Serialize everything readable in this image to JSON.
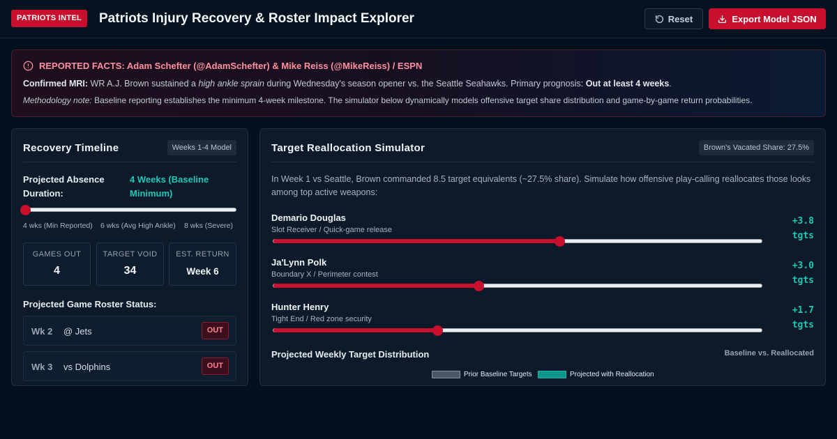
{
  "header": {
    "badge": "PATRIOTS INTEL",
    "title": "Patriots Injury Recovery & Roster Impact Explorer",
    "reset_label": "Reset",
    "export_label": "Export Model JSON"
  },
  "alert": {
    "title": "REPORTED FACTS: Adam Schefter (@AdamSchefter) & Mike Reiss (@MikeReiss) / ESPN",
    "mri_label": "Confirmed MRI:",
    "mri_text_1": "WR A.J. Brown sustained a",
    "mri_emphasis": "high ankle sprain",
    "mri_text_2": "during Wednesday's season opener vs. the Seattle Seahawks. Primary prognosis:",
    "mri_prognosis": "Out at least 4 weeks",
    "mri_end": ".",
    "method_label": "Methodology note:",
    "method_text": "Baseline reporting establishes the minimum 4-week milestone. The simulator below dynamically models offensive target share distribution and game-by-game return probabilities."
  },
  "timeline": {
    "title": "Recovery Timeline",
    "tag": "Weeks 1-4 Model",
    "absence_label": "Projected Absence Duration:",
    "absence_value": "4 Weeks (Baseline Minimum)",
    "slider": {
      "min": 4,
      "max": 8,
      "value": 4
    },
    "ticks": [
      "4 wks (Min Reported)",
      "6 wks (Avg High Ankle)",
      "8 wks (Severe)"
    ],
    "stats": [
      {
        "label": "GAMES OUT",
        "value": "4"
      },
      {
        "label": "TARGET VOID",
        "value": "34"
      },
      {
        "label": "EST. RETURN",
        "value": "Week 6"
      }
    ],
    "roster_heading": "Projected Game Roster Status:",
    "roster": [
      {
        "week": "Wk 2",
        "opponent": "@ Jets",
        "status": "OUT"
      },
      {
        "week": "Wk 3",
        "opponent": "vs Dolphins",
        "status": "OUT"
      }
    ]
  },
  "simulator": {
    "title": "Target Reallocation Simulator",
    "tag": "Brown's Vacated Share: 27.5%",
    "description": "In Week 1 vs Seattle, Brown commanded 8.5 target equivalents (~27.5% share). Simulate how offensive play-calling reallocates those looks among top active weapons:",
    "players": [
      {
        "name": "Demario Douglas",
        "role": "Slot Receiver / Quick-game release",
        "delta": "+3.8",
        "unit": "tgts",
        "share": 0.585
      },
      {
        "name": "Ja'Lynn Polk",
        "role": "Boundary X / Perimeter contest",
        "delta": "+3.0",
        "unit": "tgts",
        "share": 0.42
      },
      {
        "name": "Hunter Henry",
        "role": "Tight End / Red zone security",
        "delta": "+1.7",
        "unit": "tgts",
        "share": 0.335
      }
    ],
    "dist_title": "Projected Weekly Target Distribution",
    "dist_subtitle": "Baseline vs. Reallocated",
    "legend": [
      {
        "label": "Prior Baseline Targets",
        "color": "#4b5563"
      },
      {
        "label": "Projected with Reallocation",
        "color": "#0f9488"
      }
    ]
  },
  "colors": {
    "accent": "#c8102e",
    "teal": "#1fc8b5",
    "background": "#03101d"
  }
}
